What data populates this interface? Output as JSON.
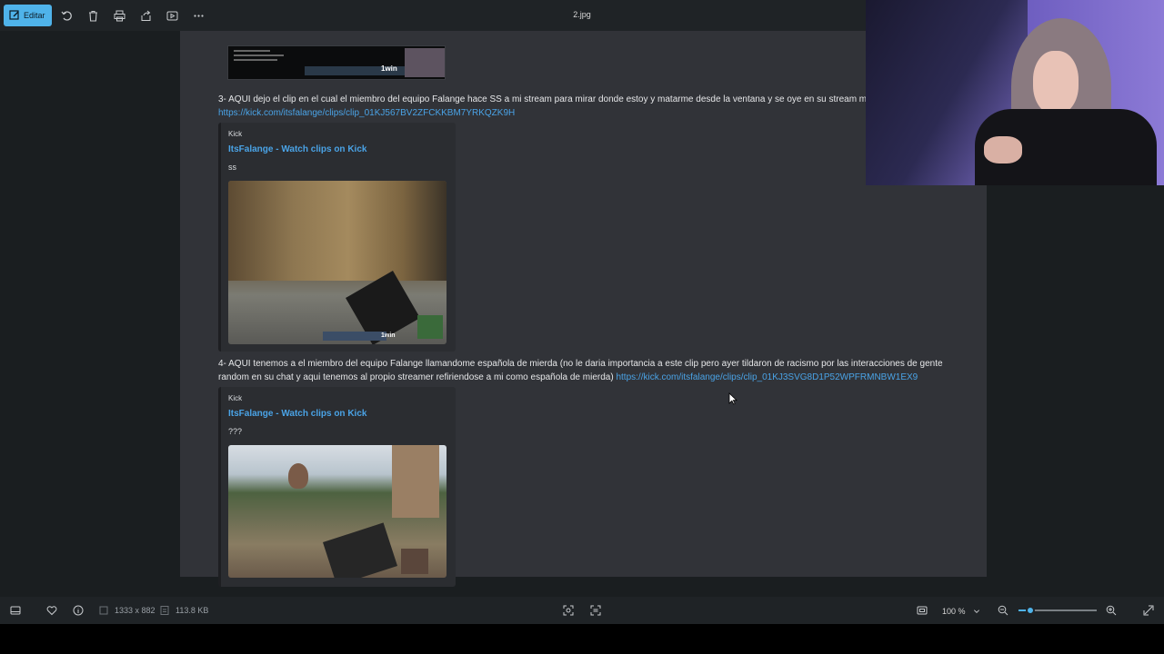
{
  "toolbar": {
    "edit_label": "Editar",
    "filename": "2.jpg"
  },
  "document": {
    "message3": "3- AQUI dejo el clip en el cual el miembro del equipo Falange hace SS a mi stream para mirar donde estoy y matarme desde la ventana y se oye en su stream m",
    "link3": "https://kick.com/itsfalange/clips/clip_01KJ567BV2ZFCKKBM7YRKQZK9H",
    "embed1": {
      "provider": "Kick",
      "title": "ItsFalange - Watch clips on Kick",
      "description": "ss",
      "logo_text": "1win"
    },
    "message4_line1": "4- AQUI tenemos a el miembro del equipo Falange llamandome española de mierda (no le daria importancia a este clip pero ayer tildaron de racismo por las interacciones de gente",
    "message4_line2": "random en su chat y aqui tenemos al propio streamer refiriendose a mi como española de mierda)",
    "link4": "https://kick.com/itsfalange/clips/clip_01KJ3SVG8D1P52WPFRMNBW1EX9",
    "embed2": {
      "provider": "Kick",
      "title": "ItsFalange - Watch clips on Kick",
      "description": "???"
    },
    "top_thumb_logo": "1win"
  },
  "statusbar": {
    "dimensions": "1333 x 882",
    "filesize": "113.8 KB",
    "zoom": "100 %",
    "zoom_fraction": 0.15
  },
  "colors": {
    "accent": "#4fb3ea",
    "link": "#4aa3e6"
  }
}
